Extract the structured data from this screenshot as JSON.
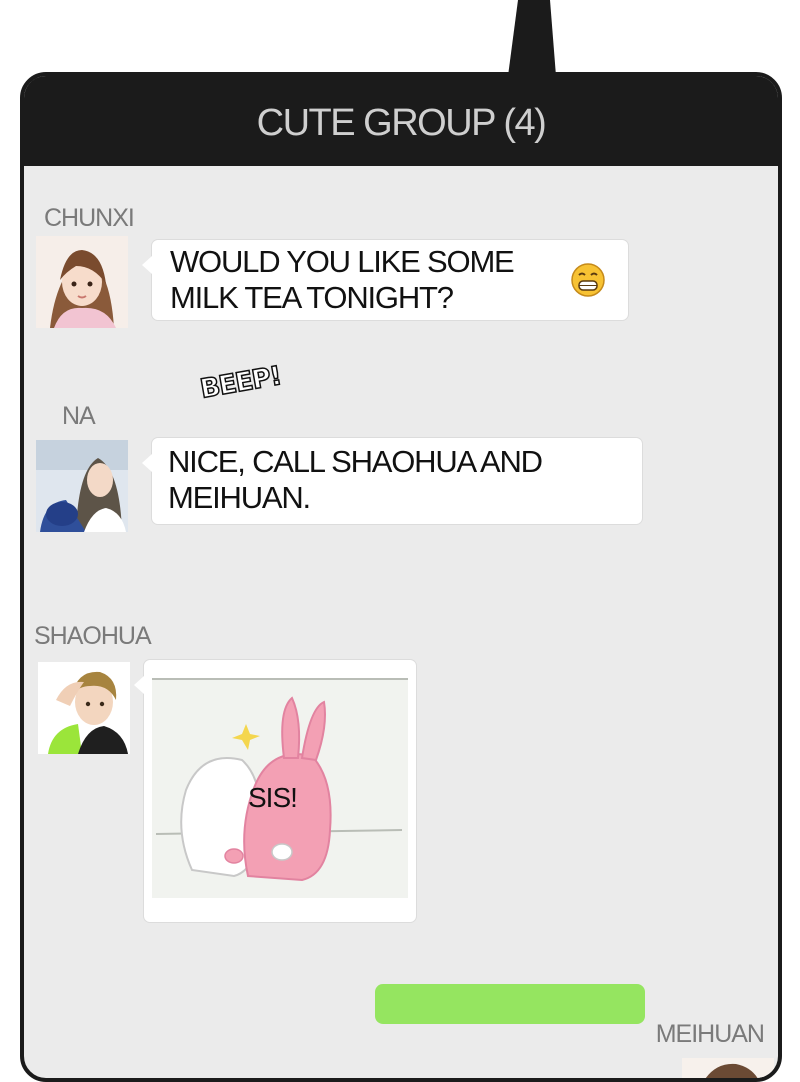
{
  "header": {
    "title": "CUTE GROUP (4)"
  },
  "messages": [
    {
      "sender": "CHUNXI",
      "text": "WOULD YOU LIKE SOME MILK TEA TONIGHT?",
      "emoji": "grinning-face-emoji"
    },
    {
      "sender": "NA",
      "text": "NICE, CALL SHAOHUA AND MEIHUAN."
    },
    {
      "sender": "SHAOHUA",
      "sticker_caption": "SIS!"
    },
    {
      "sender": "MEIHUAN"
    }
  ],
  "sfx": "BEEP!",
  "colors": {
    "header_bg": "#1b1b1b",
    "chat_bg": "#ebebeb",
    "self_bubble": "#95e560"
  }
}
